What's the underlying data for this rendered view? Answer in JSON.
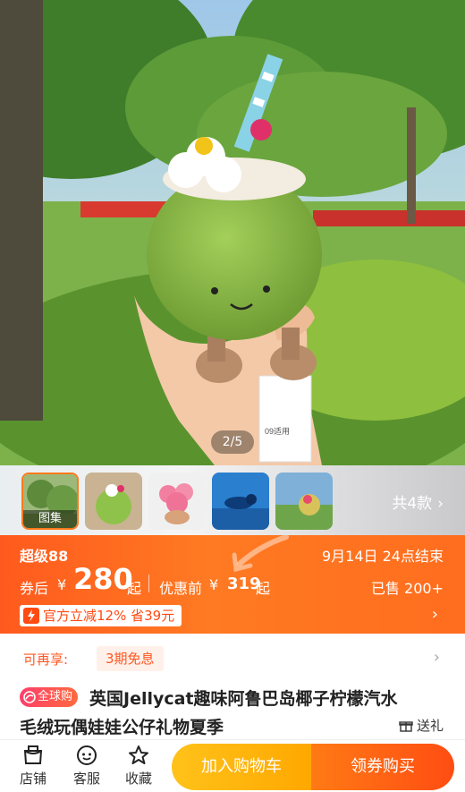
{
  "hero": {
    "page_indicator": "2/5",
    "tag_text": "09适用"
  },
  "thumbnails": {
    "items": [
      {
        "label": "图集",
        "active": true
      },
      {
        "label": ""
      },
      {
        "label": ""
      },
      {
        "label": ""
      },
      {
        "label": ""
      }
    ],
    "variants_label": "共4款",
    "chevron": "›"
  },
  "price_banner": {
    "badge": "超级88",
    "end_time": "9月14日 24点结束",
    "after_coupon_label": "券后",
    "currency": "¥",
    "price": "280",
    "price_suffix": "起",
    "orig_label": "优惠前",
    "orig_currency": "¥",
    "orig_price": "319",
    "orig_suffix": "起",
    "sold": "已售 200+",
    "promo": "官方立减12% 省39元",
    "promo_chevron": "›"
  },
  "installment": {
    "label": "可再享:",
    "chip": "3期免息",
    "chevron": "›"
  },
  "title": {
    "badge": "全球购",
    "line1": "英国Jellycat趣味阿鲁巴岛椰子柠檬汽水",
    "line2": "毛绒玩偶娃娃公仔礼物夏季",
    "gift": "送礼"
  },
  "bottom_bar": {
    "store": "店铺",
    "service": "客服",
    "favorite": "收藏",
    "add_to_cart": "加入购物车",
    "buy": "领券购买"
  },
  "colors": {
    "accent": "#ff5a1e",
    "cart": "#ffb40f",
    "buy": "#ff5a14"
  }
}
